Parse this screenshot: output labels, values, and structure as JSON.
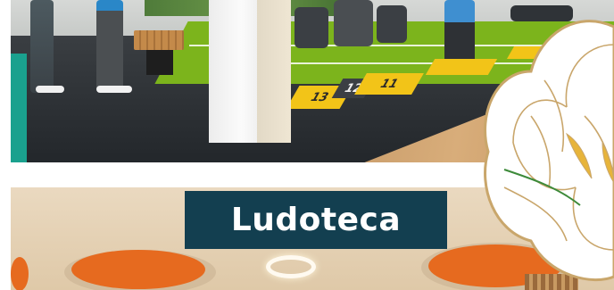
{
  "section_title": "Ludoteca",
  "gym_floor_numbers": [
    "13",
    "12",
    "11"
  ],
  "colors": {
    "title_bg": "#133f50",
    "title_text": "#ffffff",
    "turf": "#7cb41c",
    "hopscotch": "#f2c418",
    "disc_orange": "#e66a1f",
    "accent_teal": "#1aa18e"
  },
  "icons": [
    "flower-decoration-icon"
  ]
}
